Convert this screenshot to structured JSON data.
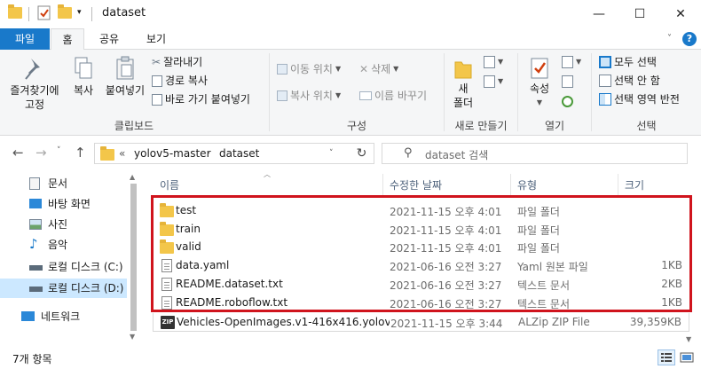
{
  "window": {
    "title": "dataset",
    "controls": {
      "minimize": "—",
      "maximize": "☐",
      "close": "✕"
    }
  },
  "ribbon": {
    "tabs": [
      {
        "label": "파일"
      },
      {
        "label": "홈"
      },
      {
        "label": "공유"
      },
      {
        "label": "보기"
      }
    ],
    "clipboard": {
      "pin_label": "즐겨찾기에\n고정",
      "copy_label": "복사",
      "paste_label": "붙여넣기",
      "cut_label": "잘라내기",
      "copy_path_label": "경로 복사",
      "paste_shortcut_label": "바로 가기 붙여넣기",
      "group_label": "클립보드"
    },
    "organize": {
      "move_to_label": "이동 위치",
      "delete_label": "삭제",
      "copy_to_label": "복사 위치",
      "rename_label": "이름 바꾸기",
      "group_label": "구성"
    },
    "new": {
      "new_folder_label": "새\n폴더",
      "group_label": "새로 만들기"
    },
    "open": {
      "properties_label": "속성",
      "group_label": "열기"
    },
    "select": {
      "select_all_label": "모두 선택",
      "select_none_label": "선택 안 함",
      "invert_label": "선택 영역 반전",
      "group_label": "선택"
    }
  },
  "address": {
    "overflow": "«",
    "crumbs": [
      "yolov5-master",
      "dataset"
    ],
    "search_placeholder": "dataset 검색"
  },
  "nav_pane": {
    "items": [
      {
        "label": "문서",
        "icon": "documents-icon"
      },
      {
        "label": "바탕 화면",
        "icon": "desktop-icon"
      },
      {
        "label": "사진",
        "icon": "pictures-icon"
      },
      {
        "label": "음악",
        "icon": "music-icon"
      },
      {
        "label": "로컬 디스크 (C:)",
        "icon": "drive-icon"
      },
      {
        "label": "로컬 디스크 (D:)",
        "icon": "drive-icon"
      },
      {
        "label": "네트워크",
        "icon": "network-icon"
      }
    ]
  },
  "file_list": {
    "columns": {
      "name": "이름",
      "date": "수정한 날짜",
      "type": "유형",
      "size": "크기"
    },
    "rows": [
      {
        "name": "test",
        "date": "2021-11-15 오후 4:01",
        "type": "파일 폴더",
        "size": "",
        "icon": "folder"
      },
      {
        "name": "train",
        "date": "2021-11-15 오후 4:01",
        "type": "파일 폴더",
        "size": "",
        "icon": "folder"
      },
      {
        "name": "valid",
        "date": "2021-11-15 오후 4:01",
        "type": "파일 폴더",
        "size": "",
        "icon": "folder"
      },
      {
        "name": "data.yaml",
        "date": "2021-06-16 오전 3:27",
        "type": "Yaml 원본 파일",
        "size": "1KB",
        "icon": "doc"
      },
      {
        "name": "README.dataset.txt",
        "date": "2021-06-16 오전 3:27",
        "type": "텍스트 문서",
        "size": "2KB",
        "icon": "doc"
      },
      {
        "name": "README.roboflow.txt",
        "date": "2021-06-16 오전 3:27",
        "type": "텍스트 문서",
        "size": "1KB",
        "icon": "doc"
      },
      {
        "name": "Vehicles-OpenImages.v1-416x416.yolov...",
        "date": "2021-11-15 오후 3:44",
        "type": "ALZip ZIP File",
        "size": "39,359KB",
        "icon": "zip"
      }
    ]
  },
  "status": {
    "item_count": "7개 항목"
  },
  "colors": {
    "accent": "#1979ca",
    "highlight_border": "#d0141d",
    "folder": "#f3c64a",
    "selection": "#cce8ff"
  }
}
